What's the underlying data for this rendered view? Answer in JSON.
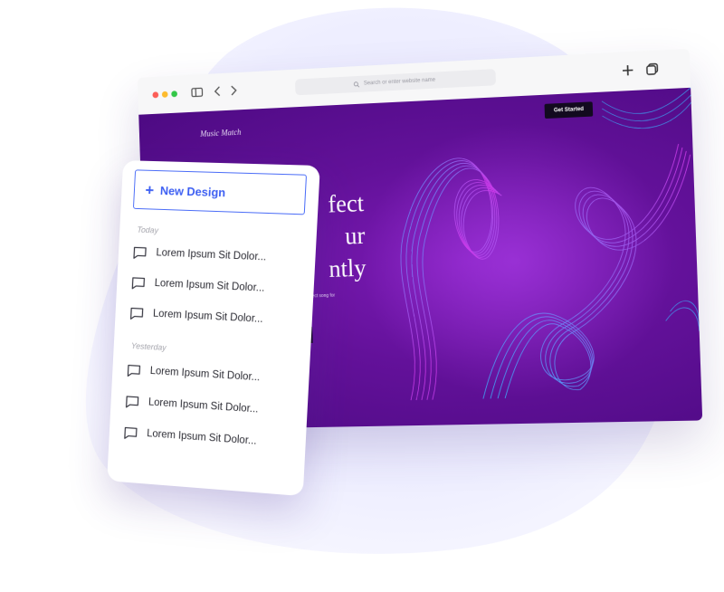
{
  "browser": {
    "address_placeholder": "Search or enter website name",
    "toolbar_icons": [
      "sidebar-icon",
      "back-icon",
      "forward-icon",
      "plus-icon",
      "tabs-icon"
    ]
  },
  "site": {
    "brand": "Music Match",
    "cta_label": "Get Started",
    "headline_lines": [
      "fect",
      "ur",
      "ntly"
    ],
    "subtext": "e perfect song for",
    "colors": {
      "hero_dark": "#4d0a83",
      "hero_mid": "#7e1cb8",
      "wave_pink": "#d63cf0",
      "wave_blue": "#3ab6ff"
    }
  },
  "panel": {
    "new_design_label": "New Design",
    "groups": [
      {
        "label": "Today",
        "items": [
          "Lorem Ipsum Sit Dolor...",
          "Lorem Ipsum Sit Dolor...",
          "Lorem Ipsum Sit Dolor..."
        ]
      },
      {
        "label": "Yesterday",
        "items": [
          "Lorem Ipsum Sit Dolor...",
          "Lorem Ipsum Sit Dolor...",
          "Lorem Ipsum Sit Dolor..."
        ]
      }
    ],
    "accent": "#3d5ff2",
    "item_icon": "chat-bubble-icon"
  }
}
